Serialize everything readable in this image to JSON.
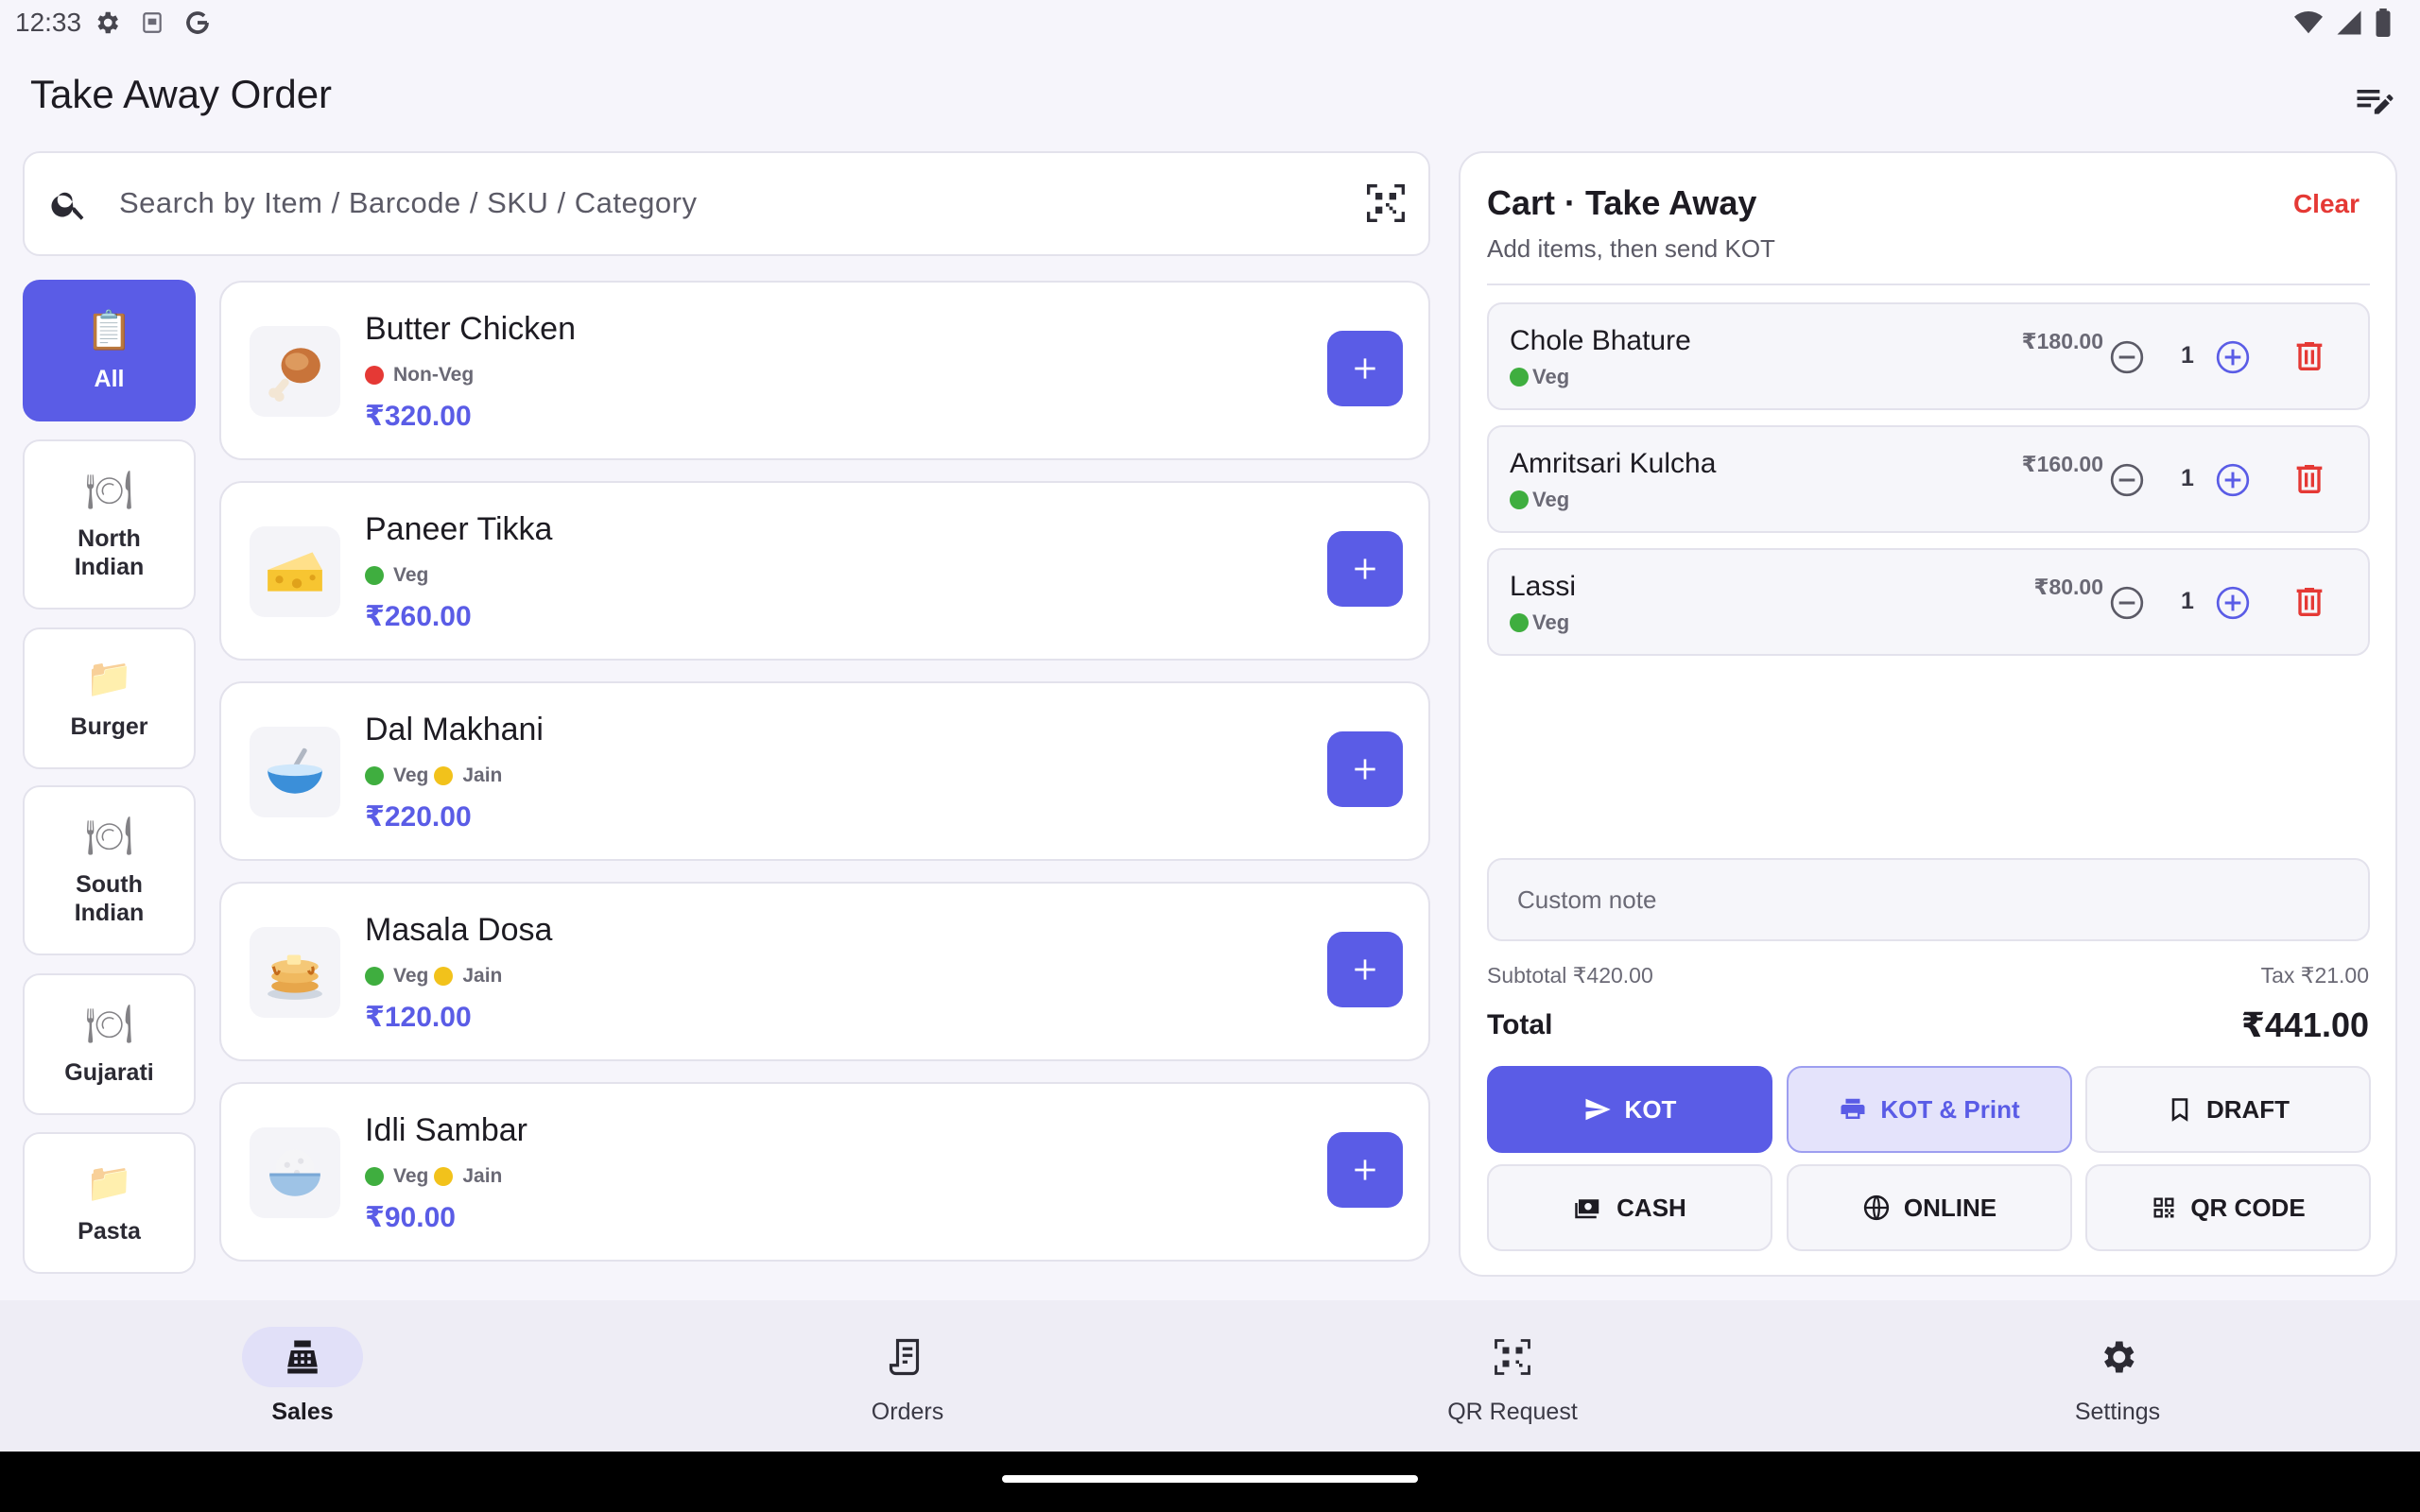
{
  "status_bar": {
    "time": "12:33",
    "left_icons": [
      "settings-icon",
      "sim-icon",
      "google-icon"
    ],
    "right_icons": [
      "wifi-icon",
      "signal-icon",
      "battery-icon"
    ]
  },
  "app_bar": {
    "title": "Take Away Order",
    "action_icon": "edit-list-icon"
  },
  "search": {
    "placeholder": "Search by Item / Barcode / SKU / Category",
    "value": "",
    "icons": [
      "search-icon",
      "qr-scan-icon"
    ]
  },
  "categories": [
    {
      "label": "All",
      "icon": "clipboard-icon",
      "glyph": "📋",
      "active": true
    },
    {
      "label": "North\nIndian",
      "icon": "plate-icon",
      "glyph": "🍽",
      "active": false
    },
    {
      "label": "Burger",
      "icon": "folder-icon",
      "glyph": "📁",
      "active": false
    },
    {
      "label": "South\nIndian",
      "icon": "plate-icon",
      "glyph": "🍽",
      "active": false
    },
    {
      "label": "Gujarati",
      "icon": "plate-icon",
      "glyph": "🍽",
      "active": false
    },
    {
      "label": "Pasta",
      "icon": "folder-icon",
      "glyph": "📁",
      "active": false
    }
  ],
  "menu_items": [
    {
      "name": "Butter Chicken",
      "tags": [
        "Non-Veg"
      ],
      "price": "₹320.00",
      "image": "chicken-leg-icon"
    },
    {
      "name": "Paneer Tikka",
      "tags": [
        "Veg"
      ],
      "price": "₹260.00",
      "image": "cheese-icon"
    },
    {
      "name": "Dal Makhani",
      "tags": [
        "Veg",
        "Jain"
      ],
      "price": "₹220.00",
      "image": "bowl-icon"
    },
    {
      "name": "Masala Dosa",
      "tags": [
        "Veg",
        "Jain"
      ],
      "price": "₹120.00",
      "image": "pancakes-icon"
    },
    {
      "name": "Idli Sambar",
      "tags": [
        "Veg",
        "Jain"
      ],
      "price": "₹90.00",
      "image": "rice-bowl-icon"
    }
  ],
  "cart": {
    "title": "Cart · Take Away",
    "subtitle": "Add items, then send KOT",
    "clear_label": "Clear",
    "items": [
      {
        "name": "Chole Bhature",
        "tag": "Veg",
        "price": "₹180.00",
        "qty": "1"
      },
      {
        "name": "Amritsari Kulcha",
        "tag": "Veg",
        "price": "₹160.00",
        "qty": "1"
      },
      {
        "name": "Lassi",
        "tag": "Veg",
        "price": "₹80.00",
        "qty": "1"
      }
    ],
    "note_placeholder": "Custom note",
    "subtotal": "Subtotal ₹420.00",
    "tax": "Tax ₹21.00",
    "total_label": "Total",
    "total_value": "₹441.00",
    "actions": [
      {
        "label": "KOT",
        "icon": "send-icon",
        "style": "primary"
      },
      {
        "label": "KOT & Print",
        "icon": "print-icon",
        "style": "tonal"
      },
      {
        "label": "DRAFT",
        "icon": "bookmark-icon",
        "style": "outline"
      },
      {
        "label": "CASH",
        "icon": "cash-icon",
        "style": "outline"
      },
      {
        "label": "ONLINE",
        "icon": "globe-icon",
        "style": "outline"
      },
      {
        "label": "QR CODE",
        "icon": "qr-code-icon",
        "style": "outline"
      }
    ]
  },
  "bottom_nav": [
    {
      "label": "Sales",
      "icon": "cash-register-icon",
      "active": true
    },
    {
      "label": "Orders",
      "icon": "receipt-icon",
      "active": false
    },
    {
      "label": "QR Request",
      "icon": "qr-code-icon",
      "active": false
    },
    {
      "label": "Settings",
      "icon": "gear-icon",
      "active": false
    }
  ],
  "colors": {
    "accent": "#5a5ce6",
    "danger": "#e53935",
    "veg": "#3fae3f",
    "non_veg": "#e53935",
    "jain": "#f2c21b",
    "background": "#f6f5fb"
  }
}
